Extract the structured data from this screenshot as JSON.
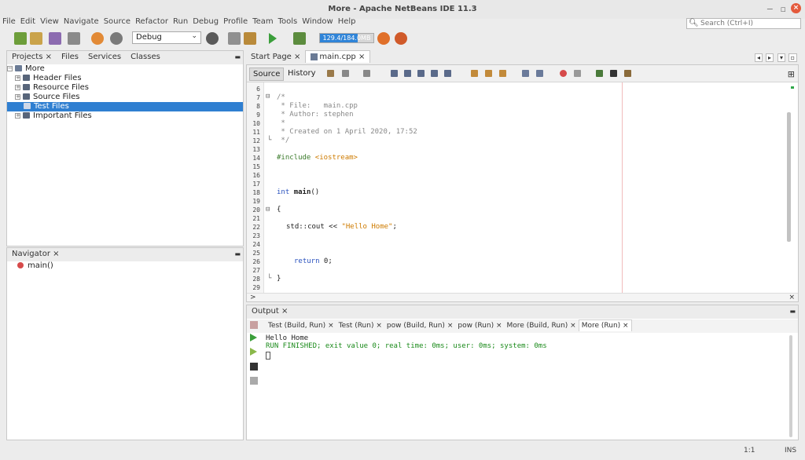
{
  "window": {
    "title": "More - Apache NetBeans IDE 11.3",
    "minimize_glyph": "−",
    "restore_glyph": "▫",
    "close_glyph": "×"
  },
  "menu": [
    "File",
    "Edit",
    "View",
    "Navigate",
    "Source",
    "Refactor",
    "Run",
    "Debug",
    "Profile",
    "Team",
    "Tools",
    "Window",
    "Help"
  ],
  "search": {
    "placeholder": "Search (Ctrl+I)",
    "icon": "search-icon"
  },
  "toolbar": {
    "config_value": "Debug",
    "memory_text": "129.4/184.0MB",
    "memory_fraction": 0.7,
    "chevron": "⌄"
  },
  "projects_panel": {
    "tabs": [
      "Projects",
      "Files",
      "Services",
      "Classes"
    ],
    "tab_close": "×",
    "root": "More",
    "items": [
      {
        "label": "Header Files",
        "selected": false
      },
      {
        "label": "Resource Files",
        "selected": false
      },
      {
        "label": "Source Files",
        "selected": false
      },
      {
        "label": "Test Files",
        "selected": true
      },
      {
        "label": "Important Files",
        "selected": false
      }
    ],
    "expander": "+",
    "root_expander": "−"
  },
  "navigator": {
    "tab_label": "Navigator",
    "tab_close": "×",
    "items": [
      "main()"
    ]
  },
  "editor": {
    "tabs": [
      {
        "label": "Start Page",
        "active": false
      },
      {
        "label": "main.cpp",
        "active": true
      }
    ],
    "tab_close": "×",
    "source_tab": "Source",
    "history_tab": "History",
    "scroll_arrow": ">",
    "lines": [
      {
        "n": "6",
        "t": ""
      },
      {
        "n": "7",
        "t": "/*"
      },
      {
        "n": "8",
        "t": " * File:   main.cpp"
      },
      {
        "n": "9",
        "t": " * Author: stephen"
      },
      {
        "n": "10",
        "t": " *"
      },
      {
        "n": "11",
        "t": " * Created on 1 April 2020, 17:52"
      },
      {
        "n": "12",
        "t": " */"
      },
      {
        "n": "13",
        "t": ""
      },
      {
        "n": "14",
        "t": "#include <iostream>"
      },
      {
        "n": "15",
        "t": ""
      },
      {
        "n": "16",
        "t": ""
      },
      {
        "n": "17",
        "t": ""
      },
      {
        "n": "18",
        "t": "int main()"
      },
      {
        "n": "19",
        "t": ""
      },
      {
        "n": "20",
        "t": "{"
      },
      {
        "n": "21",
        "t": ""
      },
      {
        "n": "22",
        "t": "std::cout << \"Hello Home\";"
      },
      {
        "n": "23",
        "t": ""
      },
      {
        "n": "24",
        "t": ""
      },
      {
        "n": "25",
        "t": ""
      },
      {
        "n": "26",
        "t": "return 0;"
      },
      {
        "n": "27",
        "t": ""
      },
      {
        "n": "28",
        "t": "}"
      },
      {
        "n": "29",
        "t": ""
      }
    ],
    "fold_open": "⊟",
    "fold_end": "└"
  },
  "code": {
    "comment_open": "/*",
    "file_line": " * File:   main.cpp",
    "author_line": " * Author: stephen",
    "star_line": " *",
    "created_line": " * Created on 1 April 2020, 17:52",
    "comment_close": " */",
    "include": "#include ",
    "include_target": "<iostream>",
    "int_kw": "int ",
    "main_fn": "main",
    "parens": "()",
    "open_brace": "{",
    "cout": "std::cout << ",
    "cout_str": "\"Hello Home\"",
    "semicolon": ";",
    "return_kw": "return",
    "return_rest": " 0;",
    "close_brace": "}"
  },
  "output": {
    "tab_label": "Output",
    "tab_close": "×",
    "tabs": [
      {
        "label": "Test (Build, Run)",
        "active": false
      },
      {
        "label": "Test (Run)",
        "active": false
      },
      {
        "label": "pow (Build, Run)",
        "active": false
      },
      {
        "label": "pow (Run)",
        "active": false
      },
      {
        "label": "More (Build, Run)",
        "active": false
      },
      {
        "label": "More (Run)",
        "active": true
      }
    ],
    "lines": [
      "Hello Home",
      "RUN FINISHED; exit value 0; real time: 0ms; user: 0ms; system: 0ms"
    ],
    "colors": {
      "stdout": "#222222",
      "finished": "#1a8a1a"
    }
  },
  "panel_controls": {
    "minimize": "▬",
    "left_arrow": "◂",
    "right_arrow": "▸",
    "down_arrow": "▾",
    "maximize": "▫",
    "close_x": "×",
    "plus": "⊞"
  },
  "status": {
    "position": "1:1",
    "mode": "INS"
  },
  "colors": {
    "selection": "#2f7fd1",
    "accent": "#2f84d8"
  }
}
